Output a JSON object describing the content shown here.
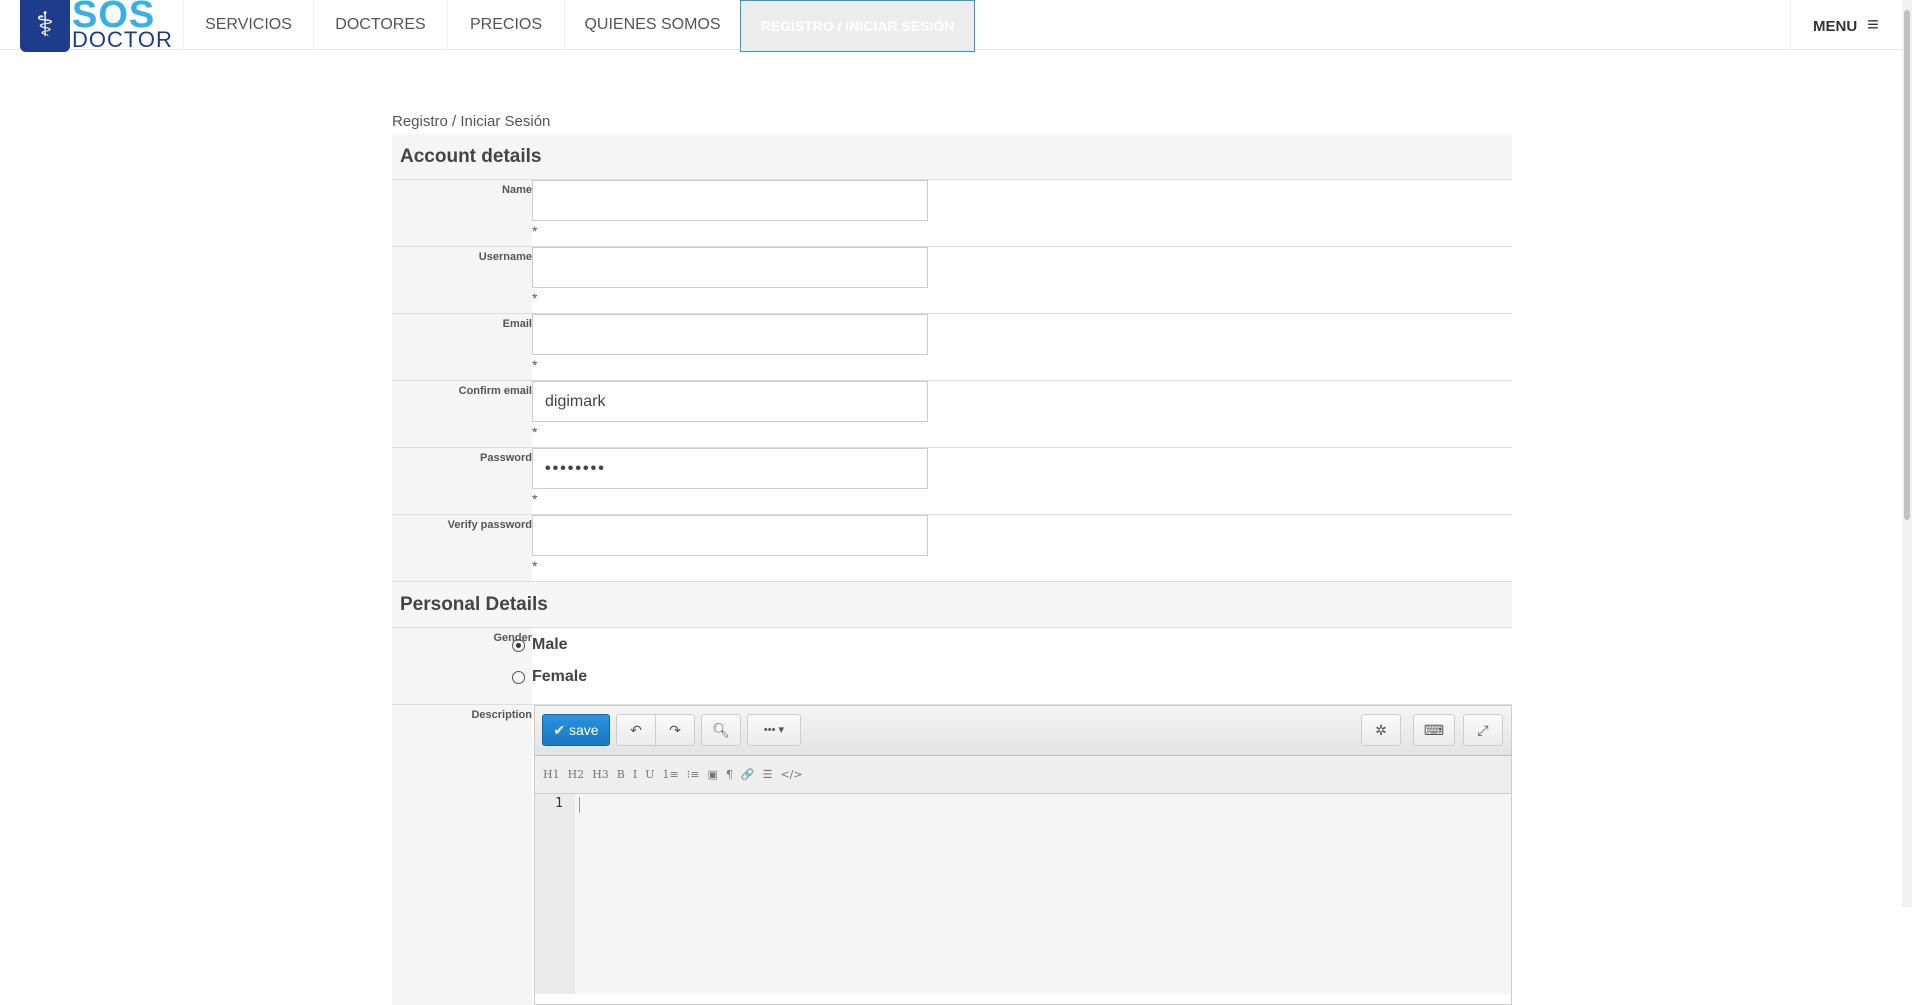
{
  "nav": {
    "logo_top": "SOS",
    "logo_bottom": "DOCTOR",
    "items": [
      {
        "label": "SERVICIOS"
      },
      {
        "label": "DOCTORES"
      },
      {
        "label": "PRECIOS"
      },
      {
        "label": "QUIENES SOMOS"
      },
      {
        "label": "REGISTRO / INICIAR SESIÓN",
        "active": true
      }
    ],
    "menu_label": "MENU",
    "menu_icon": "hamburger-icon"
  },
  "breadcrumb": "Registro / Iniciar Sesión",
  "account": {
    "title": "Account details",
    "fields": [
      {
        "label": "Name",
        "value": "",
        "required": "*"
      },
      {
        "label": "Username",
        "value": "",
        "required": "*"
      },
      {
        "label": "Email",
        "value": "",
        "required": "*"
      },
      {
        "label": "Confirm email",
        "value": "digimark",
        "required": "*"
      },
      {
        "label": "Password",
        "value": "••••••••",
        "required": "*"
      },
      {
        "label": "Verify password",
        "value": "",
        "required": "*"
      }
    ]
  },
  "personal": {
    "title": "Personal Details",
    "gender_label": "Gender",
    "options": [
      {
        "label": "Male",
        "checked": true
      },
      {
        "label": "Female",
        "checked": false
      }
    ],
    "description_label": "Description"
  },
  "editor": {
    "save_label": "save",
    "more_label": "••• ▾",
    "format_buttons": [
      "H1",
      "H2",
      "H3",
      "B",
      "I",
      "U",
      "1≡",
      "⁝≡",
      "▣",
      "¶",
      "🔗",
      "☰",
      "</>"
    ],
    "line_number": "1"
  },
  "colors": {
    "accent": "#2b9ad8",
    "logo_blue": "#1d3c8c",
    "logo_light": "#3aaee6"
  }
}
